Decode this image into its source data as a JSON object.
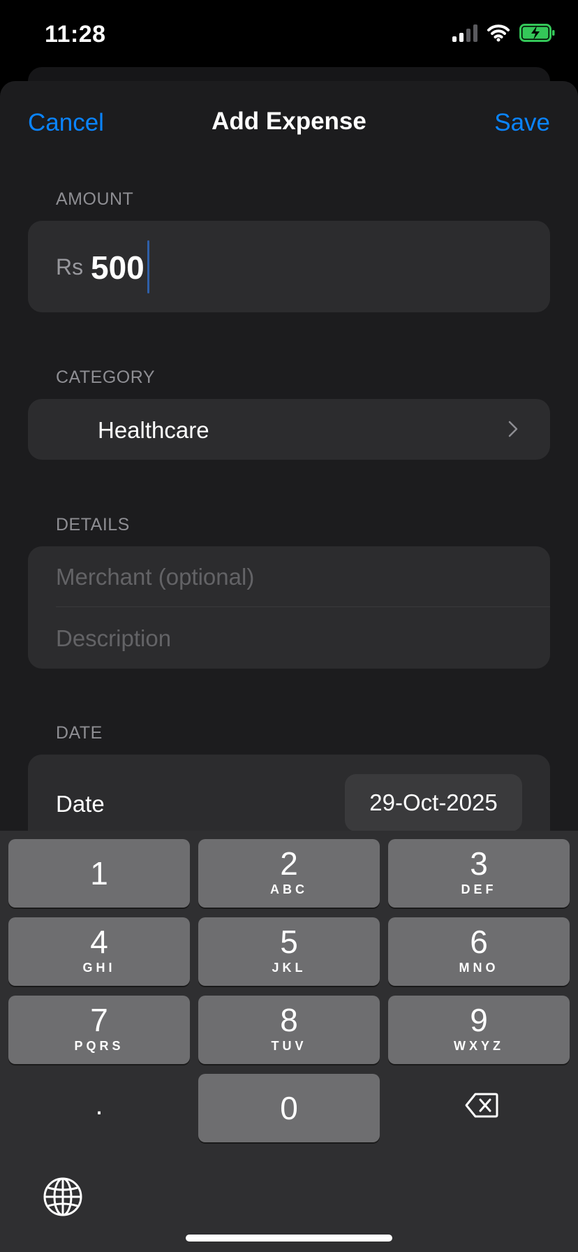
{
  "status_bar": {
    "time": "11:28"
  },
  "nav": {
    "cancel_label": "Cancel",
    "title": "Add Expense",
    "save_label": "Save"
  },
  "sections": {
    "amount_label": "AMOUNT",
    "category_label": "CATEGORY",
    "details_label": "DETAILS",
    "date_label": "DATE"
  },
  "amount": {
    "currency": "Rs",
    "value": "500"
  },
  "category": {
    "value": "Healthcare"
  },
  "details": {
    "merchant_placeholder": "Merchant (optional)",
    "description_placeholder": "Description"
  },
  "date": {
    "label": "Date",
    "value": "29-Oct-2025"
  },
  "keyboard": {
    "keys": [
      {
        "digit": "1",
        "letters": ""
      },
      {
        "digit": "2",
        "letters": "ABC"
      },
      {
        "digit": "3",
        "letters": "DEF"
      },
      {
        "digit": "4",
        "letters": "GHI"
      },
      {
        "digit": "5",
        "letters": "JKL"
      },
      {
        "digit": "6",
        "letters": "MNO"
      },
      {
        "digit": "7",
        "letters": "PQRS"
      },
      {
        "digit": "8",
        "letters": "TUV"
      },
      {
        "digit": "9",
        "letters": "WXYZ"
      },
      {
        "digit": "0",
        "letters": ""
      }
    ],
    "dot": "."
  },
  "colors": {
    "accent": "#0a84ff",
    "sheet_bg": "#1c1c1e",
    "group_bg": "#2c2c2e",
    "battery": "#34c759"
  }
}
